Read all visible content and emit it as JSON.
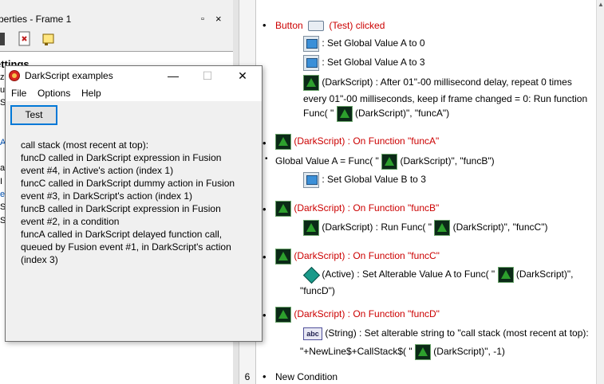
{
  "properties_panel": {
    "title": "perties - Frame 1",
    "pin_glyph": "▫",
    "close_glyph": "×",
    "settings_header": "ettings",
    "cut_rows": [
      "z",
      "u",
      "S",
      "A",
      "a",
      "I",
      "e",
      "S",
      "S"
    ]
  },
  "dialog": {
    "title": "DarkScript examples",
    "minimize_glyph": "—",
    "maximize_glyph": "☐",
    "close_glyph": "✕",
    "menu": [
      "File",
      "Options",
      "Help"
    ],
    "test_button": "Test",
    "output_lines": [
      "call stack (most recent at top):",
      "funcD called in DarkScript expression in Fusion",
      "event #4, in Active's action (index 1)",
      "funcC called in DarkScript dummy action in Fusion",
      "event #3, in DarkScript's action (index 1)",
      "funcB called in DarkScript expression in Fusion",
      "event #2, in a condition",
      "funcA called in DarkScript delayed function call,",
      "queued by Fusion event #1, in DarkScript's action",
      "(index 3)"
    ]
  },
  "events": {
    "line_number": "6",
    "e1_condition_prefix": "Button",
    "e1_condition_suffix": "(Test) clicked",
    "e1_action1": ": Set Global Value A to 0",
    "e1_action2": ": Set Global Value A to 3",
    "e1_action3_line1": "(DarkScript) : After 01\"-00 millisecond delay, repeat 0 times",
    "e1_action3_line2": "every 01\"-00 milliseconds, keep if frame changed = 0: Run function",
    "e1_action3_line3_pre": "Func( \"",
    "e1_action3_line3_post": "(DarkScript)\", \"funcA\")",
    "e2_condition": "(DarkScript) : On Function \"funcA\"",
    "e2_sub_pre": "Global Value A = Func( \"",
    "e2_sub_post": "(DarkScript)\", \"funcB\")",
    "e2_action1": ": Set Global Value B to 3",
    "e3_condition": "(DarkScript) : On Function \"funcB\"",
    "e3_action1_pre": "(DarkScript) : Run Func( \"",
    "e3_action1_post": "(DarkScript)\", \"funcC\")",
    "e4_condition": "(DarkScript) : On Function \"funcC\"",
    "e4_action1_pre": "(Active) : Set Alterable Value A to Func( \"",
    "e4_action1_post": "(DarkScript)\",",
    "e4_action1_line2": "\"funcD\")",
    "e5_condition": "(DarkScript) : On Function \"funcD\"",
    "e5_action1_line1": "(String) : Set alterable string to \"call stack (most recent at top):",
    "e5_action1_line2_pre": "\"+NewLine$+CallStack$( \"",
    "e5_action1_line2_post": "(DarkScript)\", -1)",
    "new_condition": "New Condition"
  },
  "icons": {
    "darkscript": "darkscript-icon",
    "system": "system-icon",
    "button": "button-object-icon",
    "active": "active-object-icon",
    "string": "string-object-icon",
    "abc_text": "abc"
  },
  "colors": {
    "condition_red": "#cc0000",
    "button_focus_blue": "#0078d7"
  }
}
